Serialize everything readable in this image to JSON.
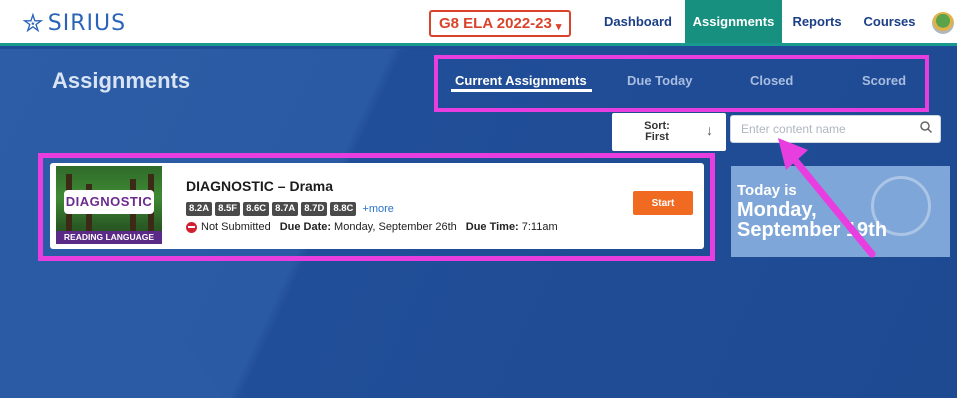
{
  "header": {
    "logo_text": "SIRIUS",
    "course": "G8 ELA 2022-23",
    "nav": [
      "Dashboard",
      "Assignments",
      "Reports",
      "Courses"
    ],
    "active_nav": "Assignments"
  },
  "page": {
    "title": "Assignments",
    "tabs": [
      "Current Assignments",
      "Due Today",
      "Closed",
      "Scored"
    ],
    "active_tab": "Current Assignments",
    "sort_label": "Sort: First",
    "search_placeholder": "Enter content name"
  },
  "assignment": {
    "thumb_badge": "DIAGNOSTIC",
    "thumb_footer": "READING LANGUAGE ARTS",
    "title": "DIAGNOSTIC – Drama",
    "tags": [
      "8.2A",
      "8.5F",
      "8.6C",
      "8.7A",
      "8.7D",
      "8.8C"
    ],
    "more": "+more",
    "status": "Not Submitted",
    "due_date_label": "Due Date:",
    "due_date": "Monday, September 26th",
    "due_time_label": "Due Time:",
    "due_time": "7:11am",
    "start_label": "Start"
  },
  "date_widget": {
    "line1": "Today is",
    "line2": "Monday,",
    "line3": "September 19th"
  },
  "colors": {
    "brand_blue": "#2a64b8",
    "nav_active": "#17907f",
    "annotation": "#e83ee0",
    "start": "#f06a22"
  }
}
